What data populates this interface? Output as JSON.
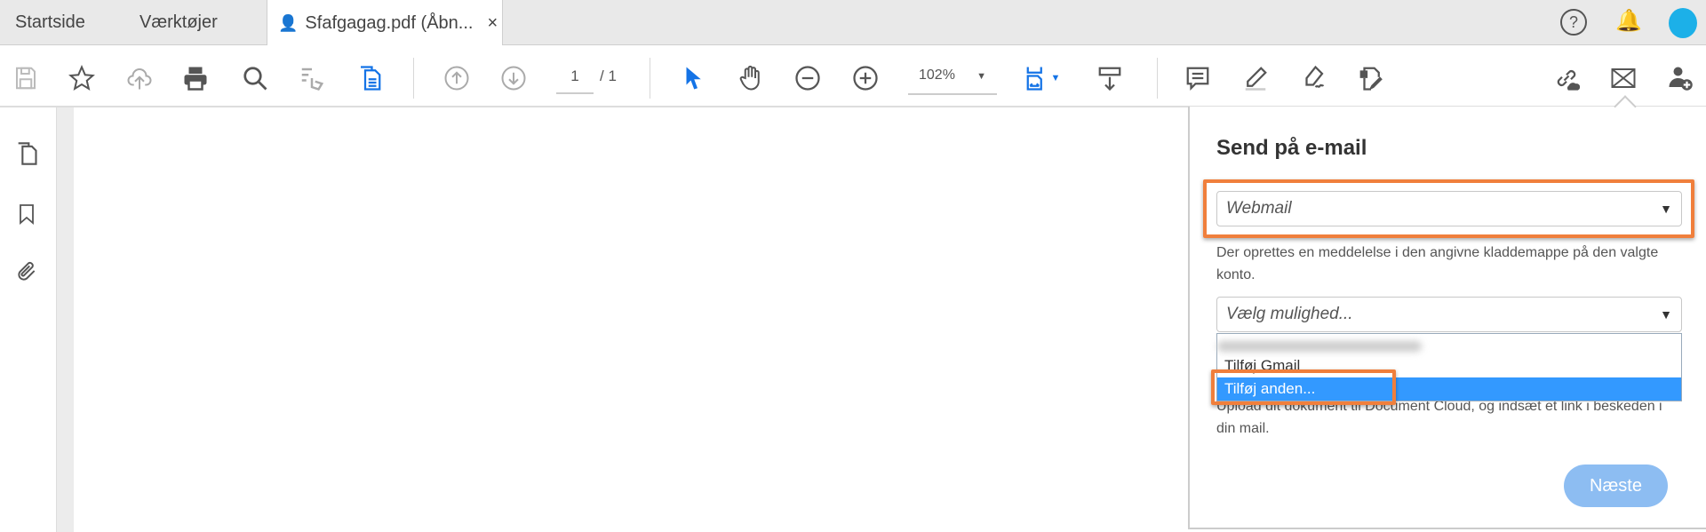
{
  "tabs": [
    {
      "label": "Startside"
    },
    {
      "label": "Værktøjer"
    },
    {
      "label": "Sfafgagag.pdf (Åbn...",
      "close": "×"
    }
  ],
  "header_icons": [
    "help-icon",
    "bell-icon",
    "avatar"
  ],
  "toolbar": {
    "page_current": "1",
    "page_total": "/ 1",
    "zoom": "102%"
  },
  "panel": {
    "title": "Send på e-mail",
    "mail_select": "Webmail",
    "description": "Der oprettes en meddelelse i den angivne kladdemappe på den valgte konto.",
    "option_select": "Vælg mulighed...",
    "options": [
      "Tilføj Gmail",
      "Tilføj anden..."
    ],
    "upload_text": "Upload dit dokument til Document Cloud, og indsæt et link i beskeden i din mail.",
    "next_button": "Næste"
  },
  "colors": {
    "accent": "#1473e6",
    "highlight": "#f07f3c",
    "selected": "#3399ff"
  }
}
